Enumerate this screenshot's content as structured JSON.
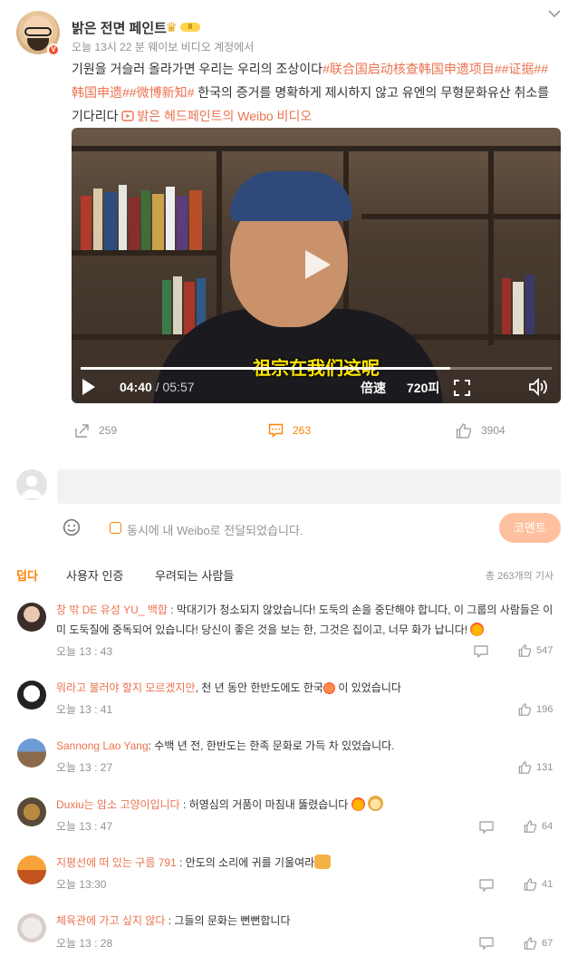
{
  "post": {
    "username": "밝은 전면 페인트",
    "vip_level": "II",
    "meta": "오늘 13시 22 분 웨이보 비디오 계정에서",
    "text_plain_1": "기원을 거슬러 올라가면 우리는 우리의 조상이다",
    "hashtag_1": "#联合国启动核查韩国申遗项目#",
    "hashtag_2": "#证据#",
    "hashtag_3": "#韩国申遗#",
    "hashtag_4": "#微博新知#",
    "text_plain_2": " 한국의 증거를 명확하게 제시하지 않고 유엔의 무형문화유산 취소를 기다리다 ",
    "video_link": "밝은 헤드페인트의 Weibo 비디오"
  },
  "video": {
    "subtitle": "祖宗在我们这呢",
    "current_time": "04:40",
    "total_time": "/ 05:57",
    "progress": 0.784,
    "speed_label": "倍速",
    "resolution_label": "720피"
  },
  "actions": {
    "share_count": "259",
    "comment_count": "263",
    "like_count": "3904"
  },
  "comment_box": {
    "repost_label": "동시에 내 Weibo로 전달되었습니다.",
    "submit_label": "코멘트"
  },
  "tabs": {
    "hot": "덥다",
    "verified": "사용자 인증",
    "concerned": "우려되는 사람들",
    "total": "총 263개의 기사"
  },
  "comments": [
    {
      "user": "창 밖 DE 유성 YU_ 백합",
      "text": " : 막대기가 청소되지 않았습니다! 도둑의 손을 중단해야 합니다, 이 그룹의 사람들은 이미 도둑질에 중독되어 있습니다! 당신이 좋은 것을 보는 한, 그것은 집이고, 너무 화가 납니다!",
      "time": "오늘 13 : 43",
      "likes": "547"
    },
    {
      "user": "뭐라고 불러야 할지 모르겠지만",
      "text": ", 천 년 동안 한반도에도 한국",
      "text_2": " 이 있었습니다",
      "time": "오늘 13 : 41",
      "likes": "196"
    },
    {
      "user": "Sannong Lao Yang",
      "text": ": 수백 년 전, 한반도는 한족 문화로 가득 차 있었습니다.",
      "time": "오늘 13 : 27",
      "likes": "131"
    },
    {
      "user": "Duxiu는 암소 고양이입니다",
      "text": " : 허영심의 거품이 마침내 뚫렸습니다",
      "time": "오늘 13 : 47",
      "likes": "64"
    },
    {
      "user": "지평선에 떠 있는 구름 791",
      "text": " : 안도의 소리에 귀를 기울여라",
      "time": "오늘 13:30",
      "likes": "41"
    },
    {
      "user": "체육관에 가고 싶지 않다",
      "text": " : 그들의 문화는 뻔뻔합니다",
      "time": "오늘 13 : 28",
      "likes": "67"
    }
  ],
  "colors": {
    "accent": "#ff8200",
    "link": "#eb7350",
    "muted": "#939393"
  }
}
